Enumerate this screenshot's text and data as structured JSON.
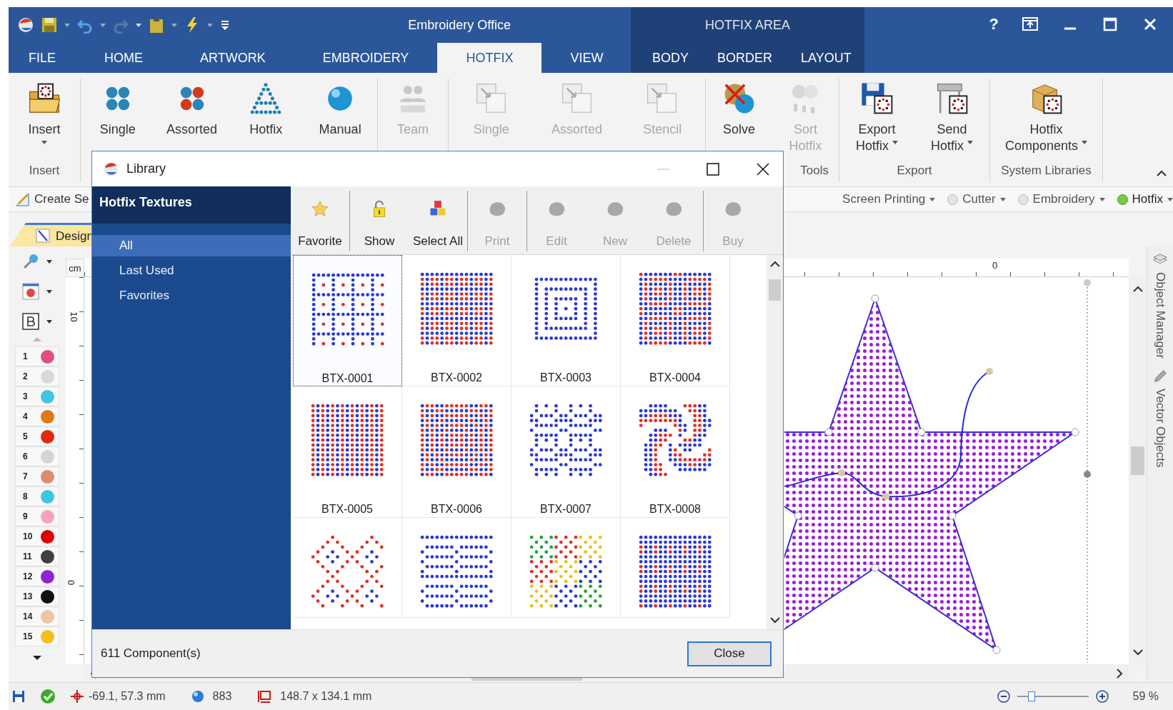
{
  "window": {
    "title": "Embroidery Office",
    "help": "?"
  },
  "tabs": [
    {
      "label": "FILE",
      "selected": false
    },
    {
      "label": "HOME",
      "selected": false
    },
    {
      "label": "ARTWORK",
      "selected": false
    },
    {
      "label": "EMBROIDERY",
      "selected": false
    },
    {
      "label": "HOTFIX",
      "selected": true
    },
    {
      "label": "VIEW",
      "selected": false
    }
  ],
  "context_group": {
    "title": "HOTFIX AREA",
    "tabs": [
      {
        "label": "BODY",
        "selected": false
      },
      {
        "label": "BORDER",
        "selected": false
      },
      {
        "label": "LAYOUT",
        "selected": false
      }
    ]
  },
  "ribbon": {
    "groups": [
      {
        "label": "Insert",
        "buttons": [
          {
            "lines": [
              "Insert"
            ],
            "kind": "folder",
            "dropdown": true,
            "disabled": false
          }
        ]
      },
      {
        "buttons": [
          {
            "lines": [
              "Single"
            ],
            "kind": "beads",
            "dropdown": false,
            "disabled": false
          },
          {
            "lines": [
              "Assorted"
            ],
            "kind": "mixed",
            "dropdown": false,
            "disabled": false
          },
          {
            "lines": [
              "Hotfix"
            ],
            "kind": "triangle",
            "dropdown": false,
            "disabled": false
          },
          {
            "lines": [
              "Manual"
            ],
            "kind": "ball",
            "dropdown": false,
            "disabled": false
          }
        ]
      },
      {
        "buttons": [
          {
            "lines": [
              "Team"
            ],
            "kind": "team",
            "dropdown": false,
            "disabled": true
          }
        ]
      },
      {
        "buttons": [
          {
            "lines": [
              "Single"
            ],
            "kind": "doc",
            "dropdown": false,
            "disabled": true
          },
          {
            "lines": [
              "Assorted"
            ],
            "kind": "doc",
            "dropdown": false,
            "disabled": true
          },
          {
            "lines": [
              "Stencil"
            ],
            "kind": "doc",
            "dropdown": false,
            "disabled": true
          }
        ]
      },
      {
        "label": "Tools",
        "buttons": [
          {
            "lines": [
              "Solve"
            ],
            "kind": "solve",
            "dropdown": false,
            "disabled": false
          },
          {
            "lines": [
              "Sort",
              "Hotfix"
            ],
            "kind": "sort",
            "dropdown": false,
            "disabled": true
          }
        ]
      },
      {
        "label": "Export",
        "buttons": [
          {
            "lines": [
              "Export",
              "Hotfix"
            ],
            "kind": "floppy",
            "dropdown": true,
            "disabled": false
          },
          {
            "lines": [
              "Send",
              "Hotfix"
            ],
            "kind": "plotter",
            "dropdown": true,
            "disabled": false
          }
        ]
      },
      {
        "label": "System Libraries",
        "buttons": [
          {
            "lines": [
              "Hotfix",
              "Components"
            ],
            "kind": "boxes",
            "dropdown": true,
            "disabled": false
          }
        ]
      }
    ]
  },
  "mode_bar": {
    "create_label": "Create Se",
    "modes": [
      {
        "label": "Screen Printing"
      },
      {
        "label": "Cutter",
        "selected": false
      },
      {
        "label": "Embroidery",
        "selected": false
      },
      {
        "label": "Hotfix",
        "selected": true
      }
    ]
  },
  "document_tabs": [
    {
      "label": "Design",
      "selected": true
    }
  ],
  "palette": [
    {
      "number": "1",
      "color": "#e0507a"
    },
    {
      "number": "2",
      "color": "#d9d9d9"
    },
    {
      "number": "3",
      "color": "#3fc6e0"
    },
    {
      "number": "4",
      "color": "#e07a12"
    },
    {
      "number": "5",
      "color": "#e02a10"
    },
    {
      "number": "6",
      "color": "#d4d4d4"
    },
    {
      "number": "7",
      "color": "#e08a70"
    },
    {
      "number": "8",
      "color": "#3fc6e0"
    },
    {
      "number": "9",
      "color": "#f2a3c4"
    },
    {
      "number": "10",
      "color": "#e00000"
    },
    {
      "number": "11",
      "color": "#404040"
    },
    {
      "number": "12",
      "color": "#9422d4"
    },
    {
      "number": "13",
      "color": "#111111"
    },
    {
      "number": "14",
      "color": "#f0c2a8"
    },
    {
      "number": "15",
      "color": "#f0c020"
    }
  ],
  "rulers": {
    "unit": "cm",
    "top_labels": [
      "0"
    ],
    "left_labels": [
      "10",
      "0"
    ]
  },
  "side_panels": [
    {
      "label": "Object Manager",
      "kind": "layers"
    },
    {
      "label": "Vector Objects",
      "kind": "pencil"
    }
  ],
  "status_bar": {
    "position": "-69.1, 57.3 mm",
    "count": "883",
    "size": "148.7 x 134.1 mm",
    "zoom": "59 %",
    "zoom_slider": {
      "level": 0.2
    }
  },
  "dialog": {
    "title": "Library",
    "sidebar": {
      "title": "Hotfix Textures",
      "items": [
        {
          "label": "All",
          "selected": true
        },
        {
          "label": "Last Used",
          "selected": false
        },
        {
          "label": "Favorites",
          "selected": false
        }
      ]
    },
    "toolbar": [
      {
        "buttons": [
          {
            "label": "Favorite",
            "kind": "star",
            "disabled": false
          }
        ]
      },
      {
        "buttons": [
          {
            "label": "Show",
            "kind": "lock",
            "disabled": false
          },
          {
            "label": "Select All",
            "kind": "cubes",
            "disabled": false
          }
        ]
      },
      {
        "buttons": [
          {
            "label": "Print",
            "kind": "blob",
            "disabled": true
          }
        ]
      },
      {
        "buttons": [
          {
            "label": "Edit",
            "kind": "blob",
            "disabled": true
          },
          {
            "label": "New",
            "kind": "blob",
            "disabled": true
          },
          {
            "label": "Delete",
            "kind": "blob",
            "disabled": true
          }
        ]
      },
      {
        "buttons": [
          {
            "label": "Buy",
            "kind": "blob",
            "disabled": true
          }
        ]
      }
    ],
    "textures": [
      {
        "label": "BTX-0001",
        "selected": true
      },
      {
        "label": "BTX-0002",
        "selected": false
      },
      {
        "label": "BTX-0003",
        "selected": false
      },
      {
        "label": "BTX-0004",
        "selected": false
      },
      {
        "label": "BTX-0005",
        "selected": false
      },
      {
        "label": "BTX-0006",
        "selected": false
      },
      {
        "label": "BTX-0007",
        "selected": false
      },
      {
        "label": "BTX-0008",
        "selected": false
      },
      {
        "selected": false
      },
      {
        "selected": false
      },
      {
        "selected": false
      },
      {
        "selected": false
      }
    ],
    "status": "611 Component(s)",
    "buttons": [
      {
        "label": "Close",
        "default": true
      }
    ]
  }
}
